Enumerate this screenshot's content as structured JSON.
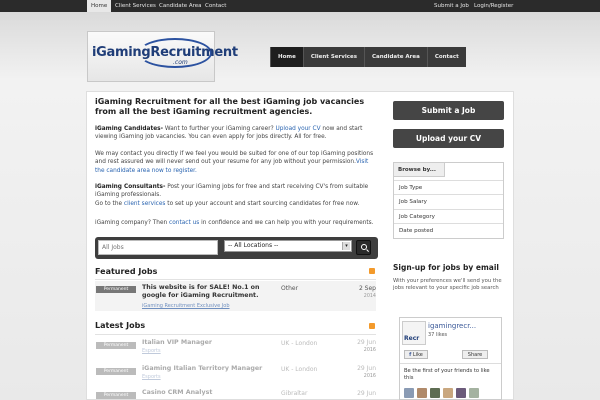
{
  "topnav": {
    "home": "Home",
    "client_services": "Client Services",
    "candidate_area": "Candidate Area",
    "contact": "Contact",
    "submit_job": "Submit a Job",
    "login_register": "Login/Register"
  },
  "logo": {
    "name": "iGamingRecruitment",
    "domain": ".com"
  },
  "mainnav": [
    "Home",
    "Client Services",
    "Candidate Area",
    "Contact"
  ],
  "intro": {
    "title": "iGaming Recruitment for all the best iGaming job vacancies from all the best iGaming recruitment agencies.",
    "p1_label": "iGaming Candidates-",
    "p1_a": " Want to further your iGaming career? ",
    "p1_link": "Upload your CV",
    "p1_b": " now and start viewing iGaming job vacancies. You can even apply for jobs directly. All for free.",
    "p2_a": "We may contact you directly if we feel you would be suited for one of our top iGaming positions and rest assured we will never send out your resume for any job without your permission.",
    "p2_link": "Visit the candidate area now to register.",
    "p3_label": "iGaming Consultants-",
    "p3_a": " Post your iGaming jobs for free and start receiving CV's from suitable iGaming professionals.",
    "p3_b": "Go to the ",
    "p3_link": "client services",
    "p3_c": " to set up your account and start sourcing candidates for free now.",
    "p4_a": "iGaming company? Then ",
    "p4_link": "contact us",
    "p4_b": " in confidence and we can help you with your requirements."
  },
  "search": {
    "placeholder": "All Jobs",
    "location": "-- All Locations --"
  },
  "featured": {
    "title": "Featured Jobs",
    "badge": "Permanent",
    "job_title": "This website is for SALE! No.1 on google for iGaming Recruitment.",
    "job_sub": "iGaming Recruitment Exclusive Job",
    "location": "Other",
    "date": "2 Sep",
    "year": "2014"
  },
  "latest": {
    "title": "Latest Jobs",
    "jobs": [
      {
        "badge": "Permanent",
        "title": "Italian VIP Manager",
        "sub": "Esports",
        "location": "UK - London",
        "date": "29 Jun",
        "year": "2016"
      },
      {
        "badge": "Permanent",
        "title": "iGaming Italian Territory Manager",
        "sub": "Esports",
        "location": "UK - London",
        "date": "29 Jun",
        "year": "2016"
      },
      {
        "badge": "Permanent",
        "title": "Casino CRM Analyst",
        "sub": "",
        "location": "Gibraltar",
        "date": "29 Jun",
        "year": ""
      }
    ]
  },
  "sidebar": {
    "submit_job": "Submit a Job",
    "upload_cv": "Upload your CV",
    "browse_by": "Browse by...",
    "browse_items": [
      "Job Type",
      "Job Salary",
      "Job Category",
      "Date posted"
    ],
    "signup_title": "Sign-up for jobs by email",
    "signup_text": "With your preferences we'll send you the jobs relevant to your specific job search"
  },
  "facebook": {
    "page_name": "igamingrecr...",
    "likes": "37 likes",
    "logo_text": "Recr",
    "like_label": "Like",
    "share_label": "Share",
    "friends_text": "Be the first of your friends to like this"
  },
  "colors": {
    "link": "#2a64b0",
    "rss": "#f39a2b",
    "facebook": "#3b5998"
  }
}
